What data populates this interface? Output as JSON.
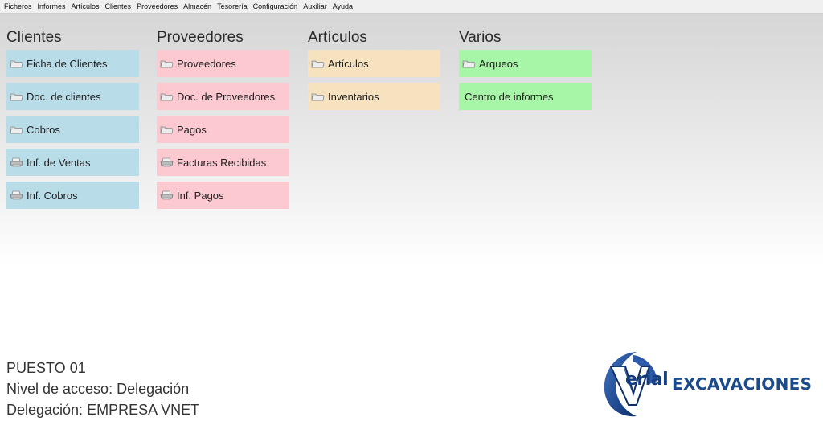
{
  "menu": [
    "Ficheros",
    "Informes",
    "Artículos",
    "Clientes",
    "Proveedores",
    "Almacén",
    "Tesorería",
    "Configuración",
    "Auxiliar",
    "Ayuda"
  ],
  "sections": {
    "clientes": {
      "title": "Clientes",
      "items": [
        "Ficha de Clientes",
        "Doc. de clientes",
        "Cobros",
        "Inf. de Ventas",
        "Inf. Cobros"
      ]
    },
    "proveedores": {
      "title": "Proveedores",
      "items": [
        "Proveedores",
        "Doc. de Proveedores",
        "Pagos",
        "Facturas Recibidas",
        "Inf. Pagos"
      ]
    },
    "articulos": {
      "title": "Artículos",
      "items": [
        "Artículos",
        "Inventarios"
      ]
    },
    "varios": {
      "title": "Varios",
      "items": [
        "Arqueos",
        "Centro de informes"
      ]
    }
  },
  "status": {
    "puesto": "PUESTO 01",
    "nivel": "Nivel de acceso: Delegación",
    "delegacion": "Delegación: EMPRESA VNET"
  },
  "logo": {
    "brand": "erial",
    "company": "EXCAVACIONES"
  },
  "colors": {
    "clientes": "#b9dce9",
    "proveedores": "#fcc9d0",
    "articulos": "#f6e2bf",
    "varios": "#a7f5a6",
    "brand_blue": "#1c4b8c"
  }
}
